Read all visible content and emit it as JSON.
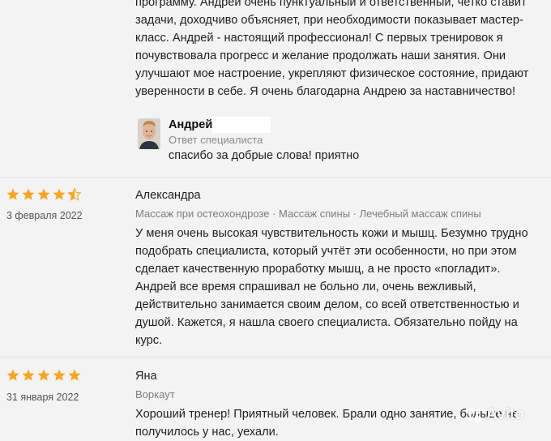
{
  "reviews": {
    "first": {
      "text_lines": [
        "программу. Андрей очень пунктуальный и ответственный, четко ставит",
        "задачи, доходчиво объясняет, при необходимости показывает мастер-",
        "класс. Андрей - настоящий профессионал! С первых тренировок я",
        "почувствовала прогресс и желание продолжать наши занятия. Они",
        "улучшают мое настроение, укрепляют физическое состояние, придают",
        "уверенности в себе. Я очень благодарна Андрею за наставничество!"
      ],
      "reply": {
        "name": "Андрей",
        "subtitle": "Ответ специалиста",
        "text": "спасибо за добрые слова! приятно"
      }
    },
    "second": {
      "rating": 4.5,
      "date": "3 февраля 2022",
      "author": "Александра",
      "tags": "Массаж при остеохондрозе · Массаж спины · Лечебный массаж спины",
      "text_lines": [
        "У меня очень высокая чувствительность кожи и мышц. Безумно трудно",
        "подобрать специалиста, который учтёт эти особенности, но при этом",
        "сделает качественную проработку мышц, а не просто «погладит».",
        "Андрей все время спрашивал не больно ли, очень вежливый,",
        "действительно занимается своим делом, со всей ответственностью и",
        "душой. Кажется, я нашла своего специалиста. Обязательно пойду на",
        "курс."
      ]
    },
    "third": {
      "rating": 5,
      "date": "31 января 2022",
      "author": "Яна",
      "tags": "Воркаут",
      "text_lines": [
        "Хороший тренер! Приятный человек. Брали одно занятие, больше не",
        "получилось у нас, уехали."
      ]
    }
  },
  "watermark": {
    "text": "Avito"
  },
  "colors": {
    "star": "#f5a623",
    "star_empty": "#d9d9d9",
    "background": "#f3f3f3",
    "divider": "#e2e2e2"
  }
}
